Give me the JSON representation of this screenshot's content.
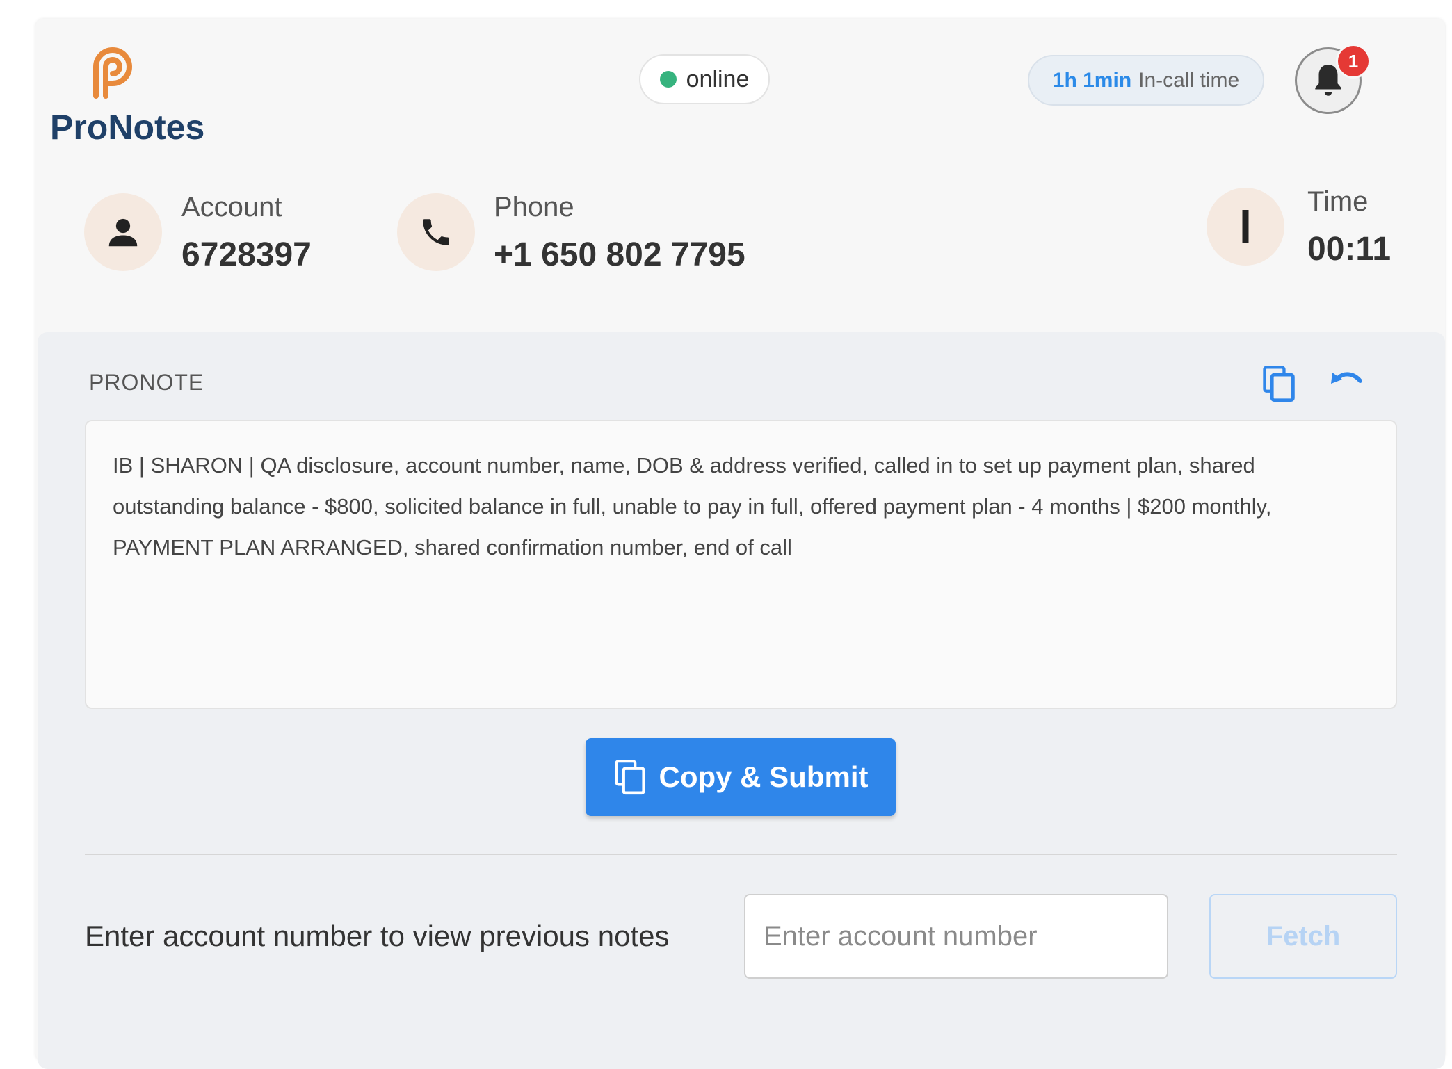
{
  "app": {
    "name": "ProNotes"
  },
  "header": {
    "status": "online",
    "in_call": {
      "value": "1h 1min",
      "label": "In-call time"
    },
    "notifications": {
      "count": "1"
    }
  },
  "call_info": {
    "account": {
      "label": "Account",
      "value": "6728397"
    },
    "phone": {
      "label": "Phone",
      "value": "+1 650 802 7795"
    },
    "time": {
      "label": "Time",
      "value": "00:11"
    }
  },
  "pronote": {
    "title": "PRONOTE",
    "text": "IB | SHARON | QA disclosure, account number, name, DOB & address verified, called in to set up payment plan, shared outstanding balance - $800, solicited balance in full, unable to pay in full, offered payment plan - 4 months | $200 monthly, PAYMENT PLAN ARRANGED, shared confirmation number, end of call",
    "submit_label": "Copy & Submit"
  },
  "previous_notes": {
    "label": "Enter account number to view previous notes",
    "placeholder": "Enter account number",
    "fetch_label": "Fetch"
  },
  "colors": {
    "brand": "#1f4068",
    "logo": "#e88a3c",
    "accent": "#2f86ea",
    "online": "#36b37e",
    "badge": "#e53935"
  },
  "icons": [
    "pronotes-logo-icon",
    "bell-icon",
    "person-icon",
    "phone-icon",
    "timer-icon",
    "copy-icon",
    "undo-icon"
  ]
}
